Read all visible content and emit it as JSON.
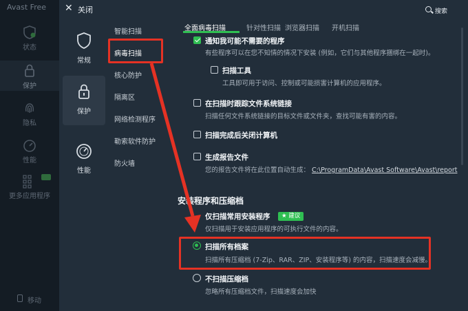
{
  "app": {
    "title": "Avast Free",
    "nav": [
      {
        "label": "状态"
      },
      {
        "label": "保护"
      },
      {
        "label": "隐私"
      },
      {
        "label": "性能"
      },
      {
        "label": "更多应用程序"
      }
    ],
    "move_label": "移动"
  },
  "header": {
    "close_label": "关闭",
    "search_label": "搜索"
  },
  "categories": [
    {
      "label": "常规",
      "icon": "shield-icon"
    },
    {
      "label": "保护",
      "icon": "lock-icon"
    },
    {
      "label": "性能",
      "icon": "gauge-icon"
    }
  ],
  "subcategories": [
    {
      "label": "智能扫描"
    },
    {
      "label": "病毒扫描"
    },
    {
      "label": "核心防护"
    },
    {
      "label": "隔离区"
    },
    {
      "label": "网络检测程序"
    },
    {
      "label": "勒索软件防护"
    },
    {
      "label": "防火墙"
    }
  ],
  "tabs": [
    {
      "label": "全面病毒扫描"
    },
    {
      "label": "针对性扫描"
    },
    {
      "label": "浏览器扫描"
    },
    {
      "label": "开机扫描"
    }
  ],
  "options": {
    "notify_pup": {
      "title": "通知我可能不需要的程序",
      "desc": "有些程序可以在您不知情的情况下安装 (例如，它们与其他程序捆绑在一起时)。",
      "checked": true
    },
    "scan_tools": {
      "title": "扫描工具",
      "desc": "工具即可用于访问、控制或可能损害计算机的应用程序。",
      "checked": false
    },
    "follow_links": {
      "title": "在扫描时跟踪文件系统链接",
      "desc": "扫描任何文件系统链接的目标文件或文件夹，查找可能有害的内容。",
      "checked": false
    },
    "shutdown": {
      "title": "扫描完成后关闭计算机",
      "checked": false
    },
    "report": {
      "title": "生成报告文件",
      "desc": "您的报告文件将在此位置自动生成：",
      "path": "C:\\ProgramData\\Avast Software\\Avast\\report",
      "checked": false
    }
  },
  "archive_section": {
    "heading": "安装程序和压缩档",
    "choices": [
      {
        "title": "仅扫描常用安装程序",
        "badge": "建议",
        "desc": "仅扫描用于安装应用程序的可执行文件的内容。",
        "selected": false
      },
      {
        "title": "扫描所有档案",
        "desc": "扫描所有压缩档 (7-Zip、RAR、ZIP、安装程序等) 的内容，扫描速度会减慢。",
        "selected": true
      },
      {
        "title": "不扫描压缩档",
        "desc": "忽略所有压缩档文件，扫描速度会加快",
        "selected": false
      }
    ]
  },
  "colors": {
    "accent": "#2fbf52",
    "highlight": "#e53224",
    "panel_bg": "#222e3a",
    "sidebar_bg": "#141c24"
  }
}
